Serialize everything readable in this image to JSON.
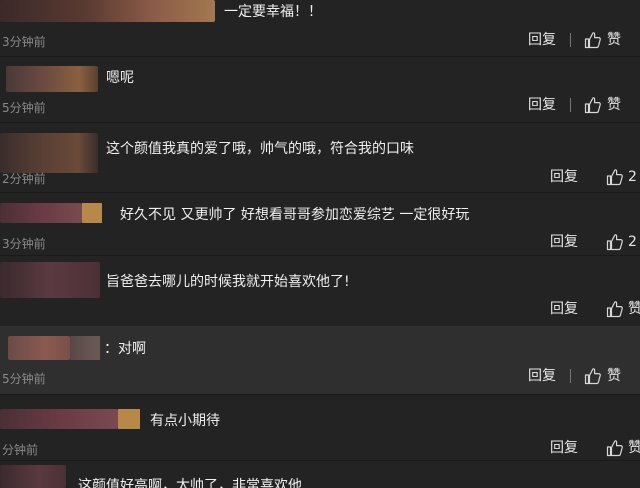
{
  "comments": [
    {
      "text": "一定要幸福！！",
      "time": "3分钟前",
      "reply": "回复",
      "like": "赞"
    },
    {
      "text": "嗯呢",
      "time": "5分钟前",
      "reply": "回复",
      "like": "赞"
    },
    {
      "text": "这个颜值我真的爱了哦，帅气的哦，符合我的口味",
      "time": "2分钟前",
      "reply": "回复",
      "like": "2"
    },
    {
      "text": "好久不见 又更帅了 好想看哥哥参加恋爱综艺 一定很好玩",
      "time": "3分钟前",
      "reply": "回复",
      "like": "2"
    },
    {
      "text": "旨爸爸去哪儿的时候我就开始喜欢他了!",
      "time": "",
      "reply": "回复",
      "like": "赞"
    },
    {
      "text": "：对啊",
      "time": "5分钟前",
      "reply": "回复",
      "like": "赞"
    },
    {
      "text": "有点小期待",
      "time": "分钟前",
      "reply": "回复",
      "like": "赞"
    },
    {
      "text": "这颜值好高啊，太帅了，非常喜欢他",
      "time": "",
      "reply": "",
      "like": ""
    }
  ],
  "colors": {
    "background": "#232323",
    "highlight": "#2f2f2f",
    "text": "#efefef",
    "muted": "#8a8a8a"
  },
  "icons": {
    "like": "thumbs-up-icon"
  }
}
